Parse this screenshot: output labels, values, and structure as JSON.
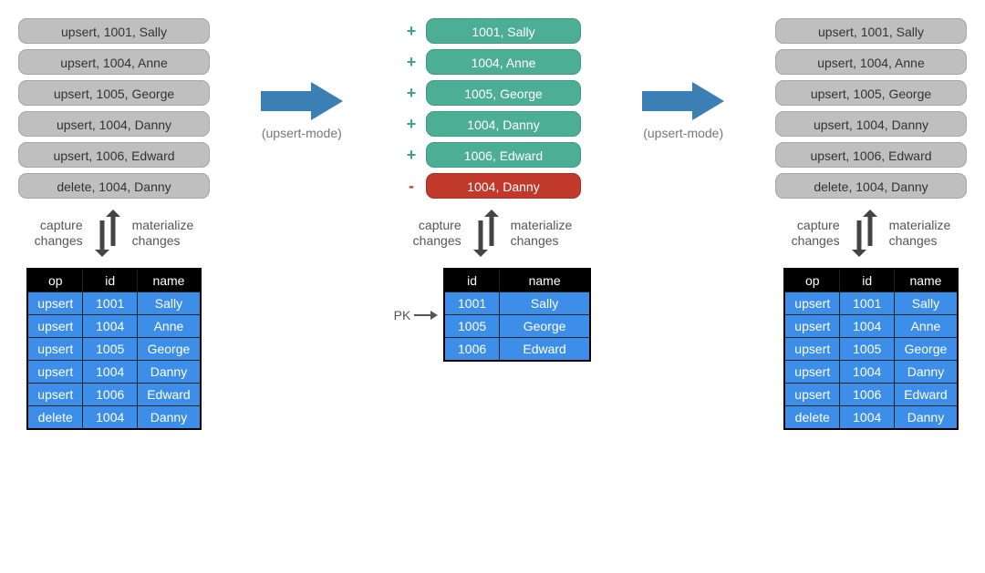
{
  "left": {
    "pills": [
      "upsert, 1001, Sally",
      "upsert, 1004, Anne",
      "upsert, 1005, George",
      "upsert, 1004, Danny",
      "upsert, 1006, Edward",
      "delete, 1004, Danny"
    ],
    "capture_label": "capture\nchanges",
    "materialize_label": "materialize\nchanges",
    "table": {
      "headers": [
        "op",
        "id",
        "name"
      ],
      "rows": [
        [
          "upsert",
          "1001",
          "Sally"
        ],
        [
          "upsert",
          "1004",
          "Anne"
        ],
        [
          "upsert",
          "1005",
          "George"
        ],
        [
          "upsert",
          "1004",
          "Danny"
        ],
        [
          "upsert",
          "1006",
          "Edward"
        ],
        [
          "delete",
          "1004",
          "Danny"
        ]
      ]
    }
  },
  "arrow1_label": "(upsert-mode)",
  "middle": {
    "pills": [
      {
        "sign": "+",
        "color": "green",
        "text": "1001, Sally"
      },
      {
        "sign": "+",
        "color": "green",
        "text": "1004, Anne"
      },
      {
        "sign": "+",
        "color": "green",
        "text": "1005, George"
      },
      {
        "sign": "+",
        "color": "green",
        "text": "1004, Danny"
      },
      {
        "sign": "+",
        "color": "green",
        "text": "1006, Edward"
      },
      {
        "sign": "-",
        "color": "red",
        "text": "1004, Danny"
      }
    ],
    "capture_label": "capture\nchanges",
    "materialize_label": "materialize\nchanges",
    "pk_label": "PK",
    "table": {
      "headers": [
        "id",
        "name"
      ],
      "rows": [
        [
          "1001",
          "Sally"
        ],
        [
          "1005",
          "George"
        ],
        [
          "1006",
          "Edward"
        ]
      ]
    }
  },
  "arrow2_label": "(upsert-mode)",
  "right": {
    "pills": [
      "upsert, 1001, Sally",
      "upsert, 1004, Anne",
      "upsert, 1005, George",
      "upsert, 1004, Danny",
      "upsert, 1006, Edward",
      "delete, 1004, Danny"
    ],
    "capture_label": "capture\nchanges",
    "materialize_label": "materialize\nchanges",
    "table": {
      "headers": [
        "op",
        "id",
        "name"
      ],
      "rows": [
        [
          "upsert",
          "1001",
          "Sally"
        ],
        [
          "upsert",
          "1004",
          "Anne"
        ],
        [
          "upsert",
          "1005",
          "George"
        ],
        [
          "upsert",
          "1004",
          "Danny"
        ],
        [
          "upsert",
          "1006",
          "Edward"
        ],
        [
          "delete",
          "1004",
          "Danny"
        ]
      ]
    }
  }
}
